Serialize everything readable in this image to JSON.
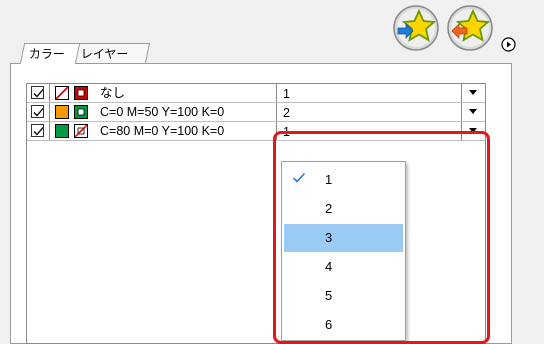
{
  "tabs": [
    {
      "label": "カラー",
      "active": true
    },
    {
      "label": "レイヤー",
      "active": false
    }
  ],
  "toolbar": {
    "star_in_icon": "star-import-icon",
    "star_out_icon": "star-export-icon",
    "menu_icon": "circle-arrow-icon"
  },
  "rows": [
    {
      "checked": true,
      "fill": "none-slash",
      "stroke": "#d40000",
      "label": "なし",
      "value": "1"
    },
    {
      "checked": true,
      "fill": "#f39800",
      "stroke": "#009944",
      "label": "C=0 M=50 Y=100 K=0",
      "value": "2"
    },
    {
      "checked": true,
      "fill": "#009944",
      "stroke": "none-slash",
      "label": "C=80 M=0 Y=100 K=0",
      "value": "1"
    }
  ],
  "dropdown": {
    "options": [
      "1",
      "2",
      "3",
      "4",
      "5",
      "6"
    ],
    "checked_option": "1",
    "highlighted_option": "3"
  },
  "colors": {
    "highlight": "#99cbf5",
    "callout_border": "#e3161a"
  }
}
